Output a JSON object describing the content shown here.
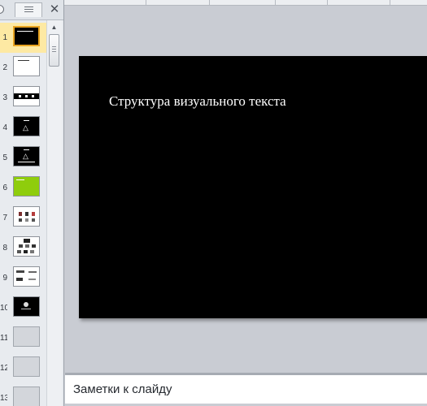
{
  "left_panel": {
    "tabs": [
      {
        "name": "slides-tab",
        "icon": "slides-tab-icon"
      },
      {
        "name": "outline-tab",
        "icon": "outline-tab-icon"
      }
    ],
    "close_glyph": "✕",
    "slides": [
      {
        "number": "1",
        "thumb": "black title slide",
        "selected": true
      },
      {
        "number": "2",
        "thumb": "white text slide"
      },
      {
        "number": "3",
        "thumb": "white slide with black banner"
      },
      {
        "number": "4",
        "thumb": "black slide with triangle"
      },
      {
        "number": "5",
        "thumb": "black slide with triangle"
      },
      {
        "number": "6",
        "thumb": "green slide"
      },
      {
        "number": "7",
        "thumb": "white slide with figures"
      },
      {
        "number": "8",
        "thumb": "white slide with image grid"
      },
      {
        "number": "9",
        "thumb": "white slide with logos"
      },
      {
        "number": "10",
        "thumb": "black slide with icon"
      },
      {
        "number": "11",
        "thumb": "empty slide"
      },
      {
        "number": "12",
        "thumb": "empty slide"
      },
      {
        "number": "13",
        "thumb": "empty slide"
      }
    ]
  },
  "slide": {
    "title": "Структура визуального текста"
  },
  "notes": {
    "placeholder": "Заметки к слайду"
  },
  "colors": {
    "selection": "#fde9a3",
    "selection_border": "#e8a320",
    "workspace": "#c9ccd3",
    "slide_background": "#000000"
  }
}
